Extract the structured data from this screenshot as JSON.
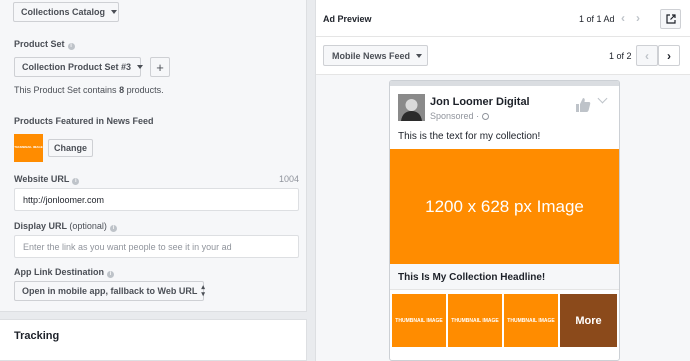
{
  "left": {
    "catalog_select": "Collections Catalog",
    "product_set_label": "Product Set",
    "product_set_select": "Collection Product Set #3",
    "add_button": "+",
    "product_set_info_pre": "This Product Set contains ",
    "product_count": "8",
    "product_set_info_post": " products.",
    "featured_label": "Products Featured in News Feed",
    "featured_thumb_text": "THUMBNAIL IMAGE",
    "change_button": "Change",
    "website_url_label": "Website URL",
    "website_url_counter": "1004",
    "website_url_value": "http://jonloomer.com",
    "display_url_label": "Display URL",
    "display_url_optional": "(optional)",
    "display_url_placeholder": "Enter the link as you want people to see it in your ad",
    "app_link_label": "App Link Destination",
    "app_link_select": "Open in mobile app, fallback to Web URL",
    "tracking_title": "Tracking"
  },
  "right": {
    "ad_preview_title": "Ad Preview",
    "ad_counter": "1 of 1 Ad",
    "placement_select": "Mobile News Feed",
    "page_counter": "1 of 2"
  },
  "post": {
    "page_name": "Jon Loomer Digital",
    "sponsored": "Sponsored",
    "separator": "·",
    "body_text": "This is the text for my collection!",
    "hero_text": "1200 x 628 px Image",
    "headline": "This Is My Collection Headline!",
    "thumbnails": [
      "THUMBNAIL IMAGE",
      "THUMBNAIL IMAGE",
      "THUMBNAIL IMAGE"
    ],
    "more_label": "More"
  },
  "colors": {
    "accent_orange": "#ff8c00",
    "more_tile": "#8b4a1b",
    "panel_bg": "#f6f7f9",
    "page_bg": "#e9ebee"
  },
  "icons": {
    "info": "info-icon",
    "caret": "caret-down-icon",
    "prev": "chevron-left-icon",
    "next": "chevron-right-icon",
    "external": "external-link-icon",
    "avatar": "avatar",
    "like": "thumbs-up-icon",
    "globe": "globe-icon"
  }
}
